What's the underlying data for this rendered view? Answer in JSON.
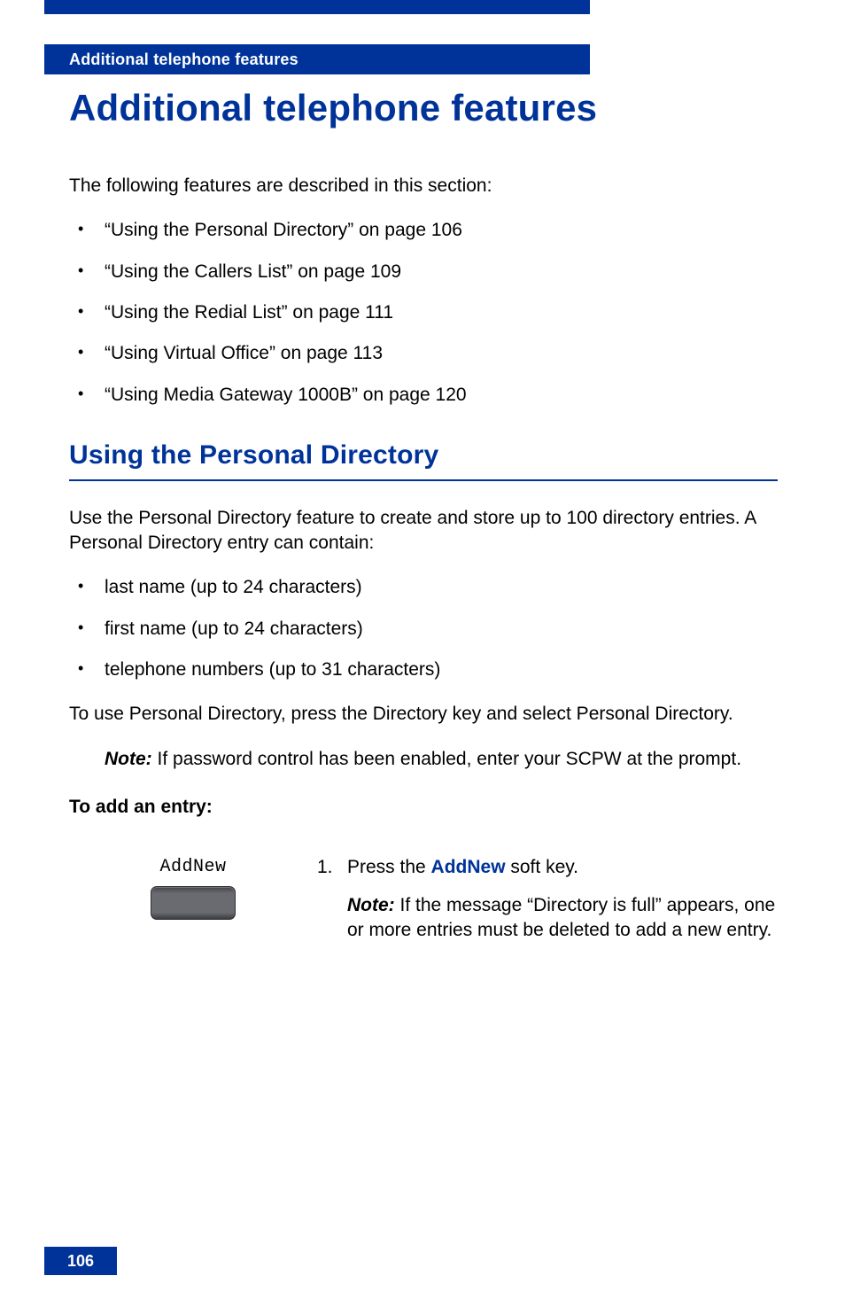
{
  "header_bar": "Additional telephone features",
  "title": "Additional telephone features",
  "intro": "The following features are described in this section:",
  "features": [
    "“Using the Personal Directory” on page 106",
    "“Using the Callers List” on page 109",
    "“Using the Redial List” on page 111",
    "“Using Virtual Office” on page 113",
    "“Using Media Gateway 1000B” on page 120"
  ],
  "section_title": "Using the Personal Directory",
  "section_intro": "Use the Personal Directory feature to create and store up to 100 directory entries. A Personal Directory entry can contain:",
  "directory_fields": [
    "last name (up to 24 characters)",
    "first name (up to 24 characters)",
    "telephone numbers (up to 31 characters)"
  ],
  "usage": "To use Personal Directory, press the Directory key and select Personal Directory.",
  "note1_label": "Note:",
  "note1_body": " If password control has been enabled, enter your SCPW at the prompt.",
  "subhead": "To add an entry:",
  "softkey": {
    "label": "AddNew"
  },
  "step1": {
    "num": "1.",
    "prefix": "Press the ",
    "soft_key": "AddNew",
    "suffix": " soft key."
  },
  "step1_note_label": "Note:",
  "step1_note_body": " If the message “Directory is full” appears, one or more entries must be deleted to add a new entry.",
  "page_number": "106"
}
